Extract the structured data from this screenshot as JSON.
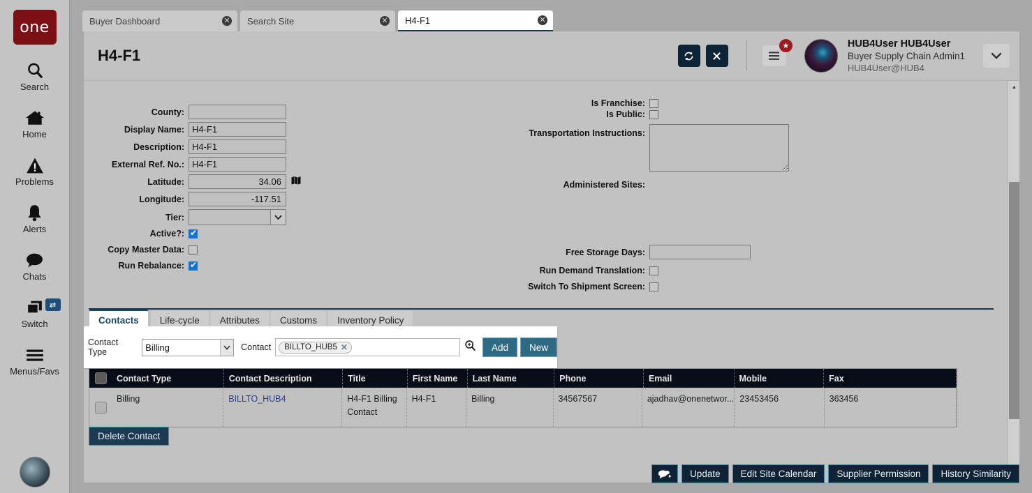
{
  "sidebar": {
    "logo_text": "one",
    "items": [
      {
        "label": "Search",
        "icon": "search-icon"
      },
      {
        "label": "Home",
        "icon": "home-icon"
      },
      {
        "label": "Problems",
        "icon": "warning-icon"
      },
      {
        "label": "Alerts",
        "icon": "bell-icon"
      },
      {
        "label": "Chats",
        "icon": "chat-icon"
      },
      {
        "label": "Switch",
        "icon": "switch-icon",
        "badge": "⇄"
      },
      {
        "label": "Menus/Favs",
        "icon": "hamburger-icon"
      }
    ]
  },
  "tabbar": {
    "tabs": [
      {
        "title": "Buyer Dashboard",
        "active": false,
        "close": "✕"
      },
      {
        "title": "Search Site",
        "active": false,
        "close": "✕"
      },
      {
        "title": "H4-F1",
        "active": true,
        "close": "✕"
      }
    ]
  },
  "header": {
    "title": "H4-F1",
    "refresh_label": "⟳",
    "close_label": "✕",
    "menu_badge": "★",
    "user_name": "HUB4User HUB4User",
    "user_role": "Buyer Supply Chain Admin1",
    "user_email": "HUB4User@HUB4",
    "caret": "⌄"
  },
  "form": {
    "left": [
      {
        "label": "County:",
        "value": "",
        "type": "text"
      },
      {
        "label": "Display Name:",
        "value": "H4-F1",
        "type": "text"
      },
      {
        "label": "Description:",
        "value": "H4-F1",
        "type": "text"
      },
      {
        "label": "External Ref. No.:",
        "value": "H4-F1",
        "type": "text"
      },
      {
        "label": "Latitude:",
        "value": "34.06",
        "type": "number"
      },
      {
        "label": "Longitude:",
        "value": "-117.51",
        "type": "number"
      },
      {
        "label": "Tier:",
        "value": "",
        "type": "select"
      },
      {
        "label": "Active?:",
        "value": true,
        "type": "checkbox"
      },
      {
        "label": "Copy Master Data:",
        "value": false,
        "type": "checkbox"
      },
      {
        "label": "Run Rebalance:",
        "value": true,
        "type": "checkbox"
      }
    ],
    "right": [
      {
        "label": "Is Franchise:",
        "value": false,
        "type": "checkbox"
      },
      {
        "label": "Is Public:",
        "value": false,
        "type": "checkbox"
      },
      {
        "label": "Transportation Instructions:",
        "value": "",
        "type": "textarea"
      },
      {
        "label": "Administered Sites:",
        "value": "",
        "type": "static"
      },
      {
        "label": "Free Storage Days:",
        "value": "",
        "type": "text"
      },
      {
        "label": "Run Demand Translation:",
        "value": false,
        "type": "checkbox"
      },
      {
        "label": "Switch To Shipment Screen:",
        "value": false,
        "type": "checkbox"
      }
    ]
  },
  "subtabs": [
    {
      "label": "Contacts",
      "active": true
    },
    {
      "label": "Life-cycle",
      "active": false
    },
    {
      "label": "Attributes",
      "active": false
    },
    {
      "label": "Customs",
      "active": false
    },
    {
      "label": "Inventory Policy",
      "active": false
    }
  ],
  "contact_bar": {
    "contact_type_label": "Contact Type",
    "contact_type_value": "Billing",
    "contact_label": "Contact",
    "chip_value": "BILLTO_HUB5",
    "chip_remove": "✕",
    "add_label": "Add",
    "new_label": "New"
  },
  "grid": {
    "columns": [
      "Contact Type",
      "Contact Description",
      "Title",
      "First Name",
      "Last Name",
      "Phone",
      "Email",
      "Mobile",
      "Fax"
    ],
    "rows": [
      {
        "contact_type": "Billing",
        "contact_description": "BILLTO_HUB4",
        "title": "H4-F1 Billing Contact",
        "first_name": "H4-F1",
        "last_name": "Billing",
        "phone": "34567567",
        "email": "ajadhav@onenetwor...",
        "mobile": "23453456",
        "fax": "363456"
      }
    ]
  },
  "delete_contact_label": "Delete Contact",
  "footer": {
    "buttons": [
      {
        "label": "💬▸",
        "name": "chat-button"
      },
      {
        "label": "Update",
        "name": "update-button"
      },
      {
        "label": "Edit Site Calendar",
        "name": "edit-site-calendar-button"
      },
      {
        "label": "Supplier Permission",
        "name": "supplier-permission-button"
      },
      {
        "label": "History Similarity",
        "name": "history-similarity-button"
      }
    ]
  },
  "colors": {
    "brand_red": "#7b0f14",
    "navy": "#0d2436",
    "teal": "#2e6a84",
    "accent_blue": "#1a6fd4",
    "header_bg": "#c2c2c2"
  }
}
